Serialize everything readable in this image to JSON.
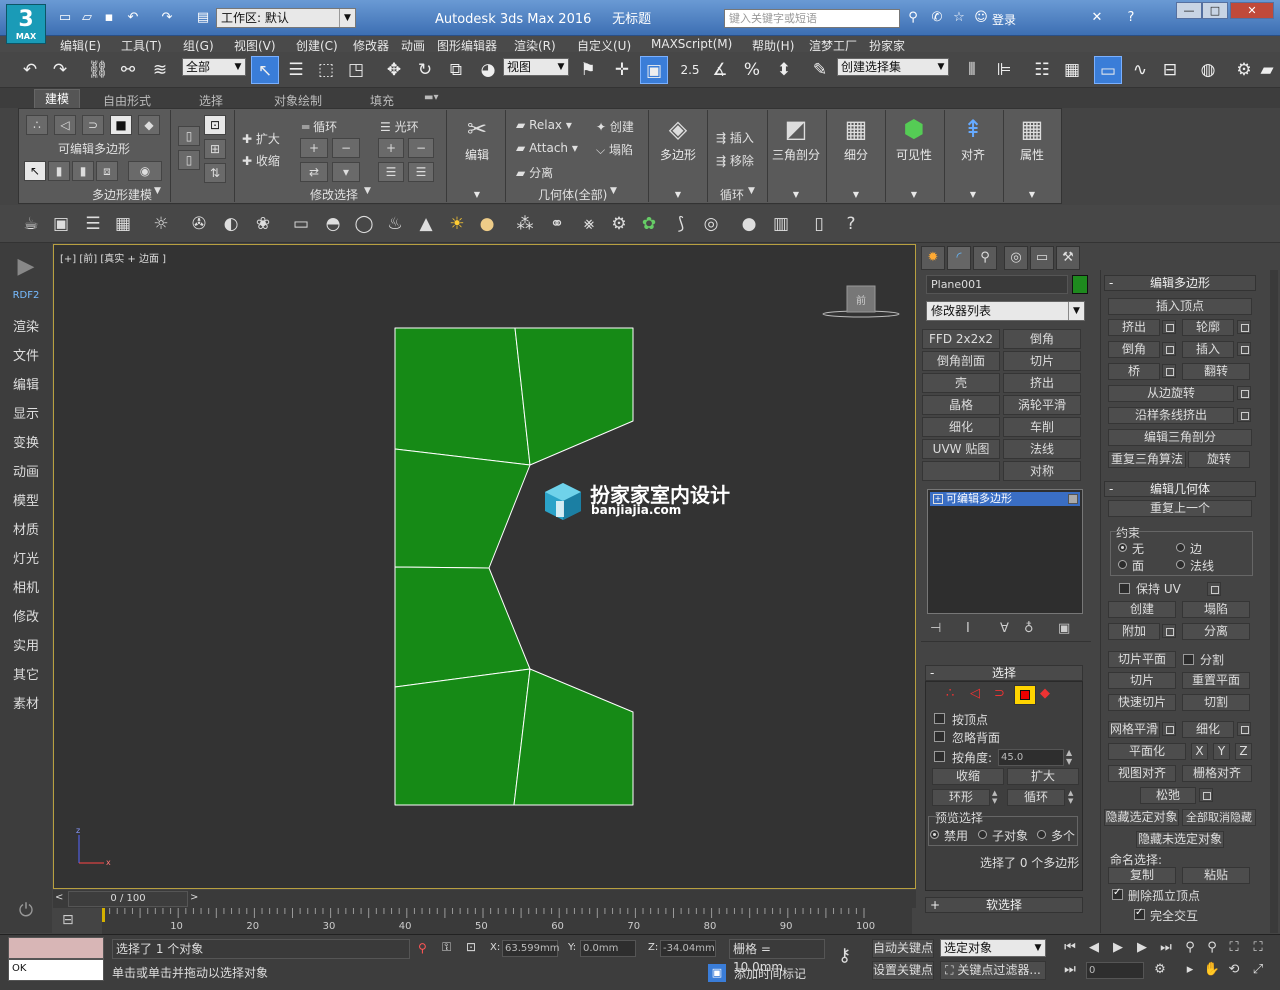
{
  "app": {
    "logo_text": "3",
    "logo_sub": "MAX",
    "title": "Autodesk 3ds Max 2016",
    "doc_title": "无标题",
    "workspace": "工作区: 默认",
    "search_placeholder": "键入关键字或短语",
    "login": "登录"
  },
  "menu": [
    "编辑(E)",
    "工具(T)",
    "组(G)",
    "视图(V)",
    "创建(C)",
    "修改器",
    "动画",
    "图形编辑器",
    "渲染(R)",
    "自定义(U)",
    "MAXScript(M)",
    "帮助(H)",
    "渲梦工厂",
    "扮家家"
  ],
  "toolbar": {
    "filter": "全部",
    "ref_coord": "视图",
    "snap_angle": "2.5",
    "named_sel": "创建选择集"
  },
  "ribbon": {
    "tabs": [
      "建模",
      "自由形式",
      "选择",
      "对象绘制",
      "填充"
    ],
    "active_tab": "建模",
    "group1_title": "可编辑多边形",
    "group1_label": "多边形建模",
    "grow": "扩大",
    "shrink": "收缩",
    "loop": "循环",
    "ring": "光环",
    "group2_label": "修改选择",
    "edit": "编辑",
    "relax": "Relax",
    "attach": "Attach",
    "detach": "分离",
    "create": "创建",
    "collapse": "塌陷",
    "group3_label": "几何体(全部)",
    "polygon": "多边形",
    "insert": "插入",
    "remove": "移除",
    "group4_label": "循环",
    "tri": "三角剖分",
    "subdivide": "细分",
    "visibility": "可见性",
    "align": "对齐",
    "props": "属性"
  },
  "cmd_panel": [
    "RDF2",
    "渲染",
    "文件",
    "编辑",
    "显示",
    "变换",
    "动画",
    "模型",
    "材质",
    "灯光",
    "相机",
    "修改",
    "实用",
    "其它",
    "素材"
  ],
  "viewport": {
    "label": "[+] [前] [真实 + 边面 ]",
    "watermark_cn": "扮家家室内设计",
    "watermark_en": "banjiajia.com",
    "poly_color": "#168a16",
    "cube_label": "前"
  },
  "right": {
    "object_name": "Plane001",
    "modifier_list": "修改器列表",
    "mods": [
      "FFD 2x2x2",
      "倒角",
      "倒角剖面",
      "切片",
      "壳",
      "挤出",
      "晶格",
      "涡轮平滑",
      "细化",
      "车削",
      "UVW 贴图",
      "法线",
      "",
      "对称"
    ],
    "stack_item": "可编辑多边形",
    "selection": {
      "title": "选择",
      "by_vertex": "按顶点",
      "ignore_back": "忽略背面",
      "by_angle": "按角度:",
      "angle_val": "45.0",
      "shrink": "收缩",
      "grow": "扩大",
      "ring": "环形",
      "loop": "循环",
      "preview": "预览选择",
      "disabled": "禁用",
      "sub_obj": "子对象",
      "multi": "多个",
      "status": "选择了 0 个多边形"
    },
    "soft_sel": "软选择"
  },
  "ep": {
    "edit_poly_title": "编辑多边形",
    "insert_vertex": "插入顶点",
    "extrude": "挤出",
    "outline": "轮廓",
    "bevel": "倒角",
    "inset": "插入",
    "bridge": "桥",
    "flip": "翻转",
    "hinge": "从边旋转",
    "extrude_spline": "沿样条线挤出",
    "edit_tri": "编辑三角剖分",
    "retri": "重复三角算法",
    "turn": "旋转",
    "edit_geo_title": "编辑几何体",
    "repeat_last": "重复上一个",
    "constraints": "约束",
    "none": "无",
    "edge": "边",
    "face": "面",
    "normal": "法线",
    "preserve_uv": "保持 UV",
    "create": "创建",
    "collapse": "塌陷",
    "attach": "附加",
    "detach": "分离",
    "slice_plane": "切片平面",
    "split": "分割",
    "slice": "切片",
    "reset_plane": "重置平面",
    "quickslice": "快速切片",
    "cut": "切割",
    "msmooth": "网格平滑",
    "tessellate": "细化",
    "make_planar": "平面化",
    "x": "X",
    "y": "Y",
    "z": "Z",
    "view_align": "视图对齐",
    "grid_align": "栅格对齐",
    "relax": "松弛",
    "hide_sel": "隐藏选定对象",
    "unhide_all": "全部取消隐藏",
    "hide_unsel": "隐藏未选定对象",
    "named_sel": "命名选择:",
    "copy": "复制",
    "paste": "粘贴",
    "delete_iso": "删除孤立顶点",
    "full_interact": "完全交互"
  },
  "timeline": {
    "frame": "0 / 100",
    "ticks": [
      "10",
      "20",
      "30",
      "40",
      "50",
      "60",
      "70",
      "80",
      "90",
      "100"
    ]
  },
  "status": {
    "ok": "OK",
    "selected": "选择了 1 个对象",
    "prompt": "单击或单击并拖动以选择对象",
    "x_label": "X:",
    "x": "63.599mm",
    "y_label": "Y:",
    "y": "0.0mm",
    "z_label": "Z:",
    "z": "-34.04mm",
    "grid": "栅格 = 10.0mm",
    "add_time_tag": "添加时间标记",
    "auto_key": "自动关键点",
    "set_key": "设置关键点",
    "sel_obj": "选定对象",
    "key_filters": "关键点过滤器...",
    "frame_num": "0"
  }
}
